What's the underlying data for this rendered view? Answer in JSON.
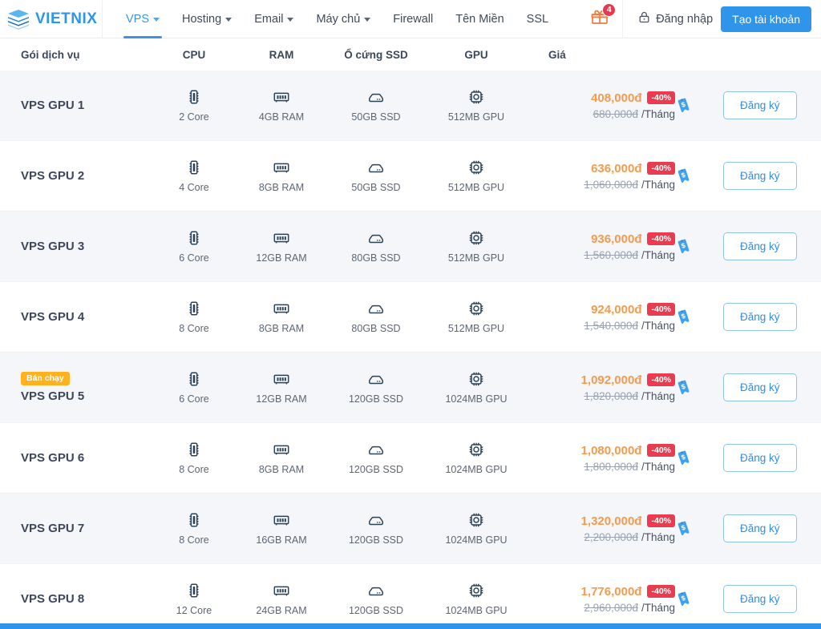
{
  "header": {
    "brand": {
      "name": "VIETNIX",
      "logo_icon": "stacked-layers-logo",
      "color": "#2f95ea"
    },
    "nav": [
      {
        "label": "VPS",
        "has_caret": true,
        "active": true
      },
      {
        "label": "Hosting",
        "has_caret": true,
        "active": false
      },
      {
        "label": "Email",
        "has_caret": true,
        "active": false
      },
      {
        "label": "Máy chủ",
        "has_caret": true,
        "active": false
      },
      {
        "label": "Firewall",
        "has_caret": false,
        "active": false
      },
      {
        "label": "Tên Miền",
        "has_caret": false,
        "active": false
      },
      {
        "label": "SSL",
        "has_caret": false,
        "active": false
      }
    ],
    "gift": {
      "icon": "gift-icon",
      "badge_count": "4",
      "badge_color": "#e8384f"
    },
    "login": {
      "label": "Đăng nhập",
      "icon": "lock-icon"
    },
    "register": {
      "label": "Tạo tài khoản",
      "color": "#2f95ea"
    }
  },
  "table": {
    "columns": {
      "name": "Gói dịch vụ",
      "cpu": "CPU",
      "ram": "RAM",
      "ssd": "Ổ cứng SSD",
      "gpu": "GPU",
      "price": "Giá"
    },
    "per_month": "/Tháng",
    "buy_label": "Đăng ký",
    "hot_badge": "Bán chạy",
    "tag_icon": "price-tag-dollar-icon",
    "icons": {
      "cpu": "cpu-chip-icon",
      "ram": "ram-stick-icon",
      "ssd": "ssd-drive-icon",
      "gpu": "gpu-chip-icon"
    },
    "rows": [
      {
        "name": "VPS GPU 1",
        "hot": false,
        "cpu": "2 Core",
        "ram": "4GB RAM",
        "ssd": "50GB SSD",
        "gpu": "512MB GPU",
        "price_new": "408,000đ",
        "price_old": "680,000đ",
        "discount": "-40%"
      },
      {
        "name": "VPS GPU 2",
        "hot": false,
        "cpu": "4 Core",
        "ram": "8GB RAM",
        "ssd": "50GB SSD",
        "gpu": "512MB GPU",
        "price_new": "636,000đ",
        "price_old": "1,060,000đ",
        "discount": "-40%"
      },
      {
        "name": "VPS GPU 3",
        "hot": false,
        "cpu": "6 Core",
        "ram": "12GB RAM",
        "ssd": "80GB SSD",
        "gpu": "512MB GPU",
        "price_new": "936,000đ",
        "price_old": "1,560,000đ",
        "discount": "-40%"
      },
      {
        "name": "VPS GPU 4",
        "hot": false,
        "cpu": "8 Core",
        "ram": "8GB RAM",
        "ssd": "80GB SSD",
        "gpu": "512MB GPU",
        "price_new": "924,000đ",
        "price_old": "1,540,000đ",
        "discount": "-40%"
      },
      {
        "name": "VPS GPU 5",
        "hot": true,
        "cpu": "6 Core",
        "ram": "12GB RAM",
        "ssd": "120GB SSD",
        "gpu": "1024MB GPU",
        "price_new": "1,092,000đ",
        "price_old": "1,820,000đ",
        "discount": "-40%"
      },
      {
        "name": "VPS GPU 6",
        "hot": false,
        "cpu": "8 Core",
        "ram": "8GB RAM",
        "ssd": "120GB SSD",
        "gpu": "1024MB GPU",
        "price_new": "1,080,000đ",
        "price_old": "1,800,000đ",
        "discount": "-40%"
      },
      {
        "name": "VPS GPU 7",
        "hot": false,
        "cpu": "8 Core",
        "ram": "16GB RAM",
        "ssd": "120GB SSD",
        "gpu": "1024MB GPU",
        "price_new": "1,320,000đ",
        "price_old": "2,200,000đ",
        "discount": "-40%"
      },
      {
        "name": "VPS GPU 8",
        "hot": false,
        "cpu": "12 Core",
        "ram": "24GB RAM",
        "ssd": "120GB SSD",
        "gpu": "1024MB GPU",
        "price_new": "1,776,000đ",
        "price_old": "2,960,000đ",
        "discount": "-40%"
      }
    ]
  }
}
